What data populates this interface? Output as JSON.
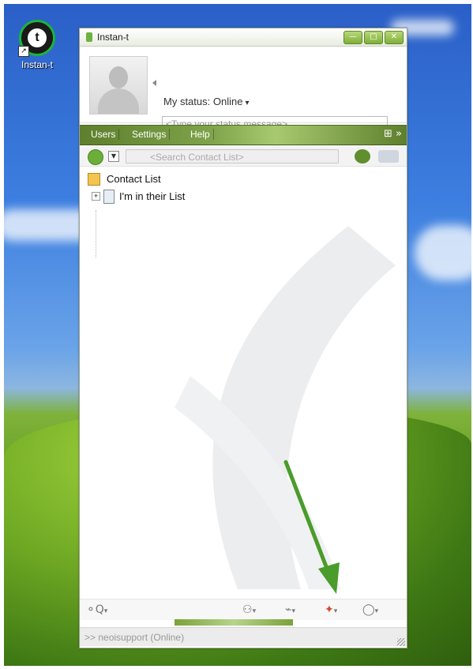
{
  "desktop": {
    "icon": {
      "label": "Instan-t",
      "name": "instant-desktop-icon"
    }
  },
  "window": {
    "title": "Instan-t",
    "controls": [
      "minimize",
      "maximize",
      "close"
    ],
    "profile": {
      "status_label": "My status: Online",
      "status_placeholder": "<Type your status message>"
    },
    "menu": [
      "Users",
      "Settings",
      "Help"
    ],
    "search_placeholder": "<Search Contact List>",
    "contact_tree": {
      "root": "Contact List",
      "children": [
        "I'm in their List"
      ]
    },
    "statusbar": ">> neoisupport (Online)"
  },
  "colors": {
    "accent": "#6cae39",
    "arrow": "#4a9c2b"
  },
  "icons": {
    "search": "magnifier-icon",
    "bottom": [
      "contacts-icon",
      "plug-icon",
      "puzzle-icon",
      "chat-bubble-icon"
    ]
  }
}
